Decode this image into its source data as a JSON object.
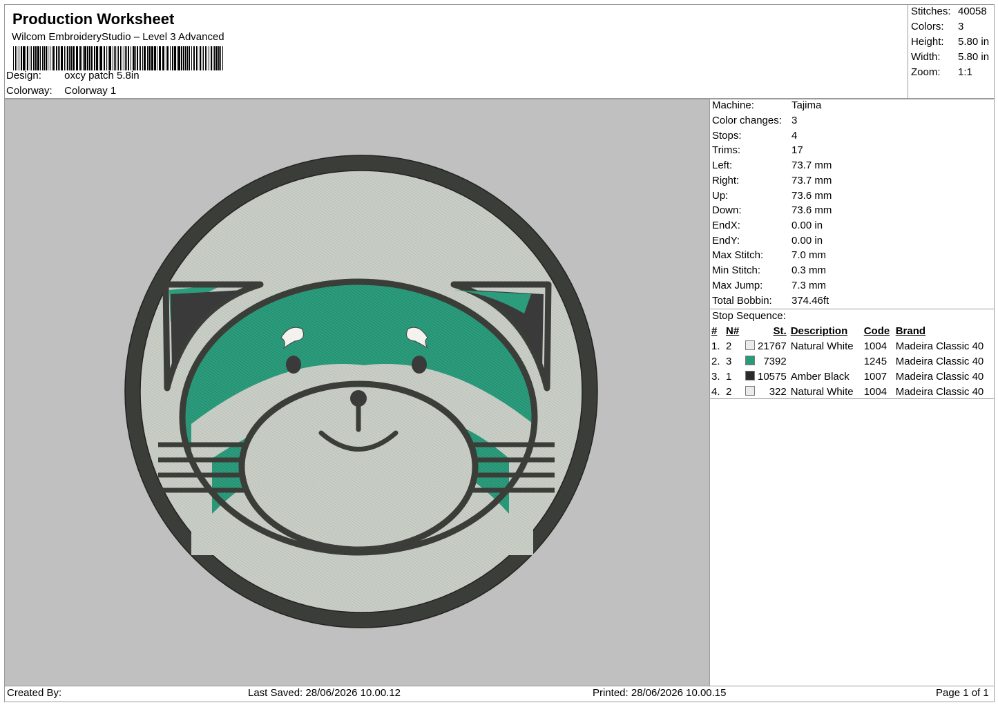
{
  "header": {
    "title": "Production Worksheet",
    "subtitle": "Wilcom EmbroideryStudio – Level 3 Advanced",
    "design_label": "Design:",
    "design_value": "oxcy patch 5.8in",
    "colorway_label": "Colorway:",
    "colorway_value": "Colorway 1"
  },
  "stats": [
    {
      "label": "Stitches:",
      "value": "40058"
    },
    {
      "label": "Colors:",
      "value": "3"
    },
    {
      "label": "Height:",
      "value": "5.80 in"
    },
    {
      "label": "Width:",
      "value": "5.80 in"
    },
    {
      "label": "Zoom:",
      "value": "1:1"
    }
  ],
  "machine_info": [
    {
      "label": "Machine:",
      "value": "Tajima"
    },
    {
      "label": "Color changes:",
      "value": "3"
    },
    {
      "label": "Stops:",
      "value": "4"
    },
    {
      "label": "Trims:",
      "value": "17"
    },
    {
      "label": "Left:",
      "value": "73.7 mm"
    },
    {
      "label": "Right:",
      "value": "73.7 mm"
    },
    {
      "label": "Up:",
      "value": "73.6 mm"
    },
    {
      "label": "Down:",
      "value": "73.6 mm"
    },
    {
      "label": "EndX:",
      "value": "0.00 in"
    },
    {
      "label": "EndY:",
      "value": "0.00 in"
    },
    {
      "label": "Max Stitch:",
      "value": "7.0 mm"
    },
    {
      "label": "Min Stitch:",
      "value": "0.3 mm"
    },
    {
      "label": "Max Jump:",
      "value": "7.3 mm"
    },
    {
      "label": "Total Bobbin:",
      "value": "374.46ft"
    }
  ],
  "stop_sequence": {
    "title": "Stop Sequence:",
    "headers": {
      "num": "#",
      "n": "N#",
      "st": "St.",
      "desc": "Description",
      "code": "Code",
      "brand": "Brand"
    },
    "rows": [
      {
        "num": "1.",
        "n": "2",
        "color": "#ebebeb",
        "st": "21767",
        "desc": "Natural White",
        "code": "1004",
        "brand": "Madeira Classic 40"
      },
      {
        "num": "2.",
        "n": "3",
        "color": "#2a9a7a",
        "st": "7392",
        "desc": "",
        "code": "1245",
        "brand": "Madeira Classic 40"
      },
      {
        "num": "3.",
        "n": "1",
        "color": "#2a2a2a",
        "st": "10575",
        "desc": "Amber Black",
        "code": "1007",
        "brand": "Madeira Classic 40"
      },
      {
        "num": "4.",
        "n": "2",
        "color": "#ebebeb",
        "st": "322",
        "desc": "Natural White",
        "code": "1004",
        "brand": "Madeira Classic 40"
      }
    ]
  },
  "footer": {
    "created_by": "Created By:",
    "last_saved": "Last Saved: 28/06/2026 10.00.12",
    "printed": "Printed: 28/06/2026 10.00.15",
    "page": "Page 1 of 1"
  },
  "colors": {
    "canvas_bg": "#c0c0c0",
    "patch_fill": "#c6cbc4",
    "outline": "#3b3d39",
    "green": "#2a9a7a",
    "dark_ear": "#3a3a3a"
  }
}
